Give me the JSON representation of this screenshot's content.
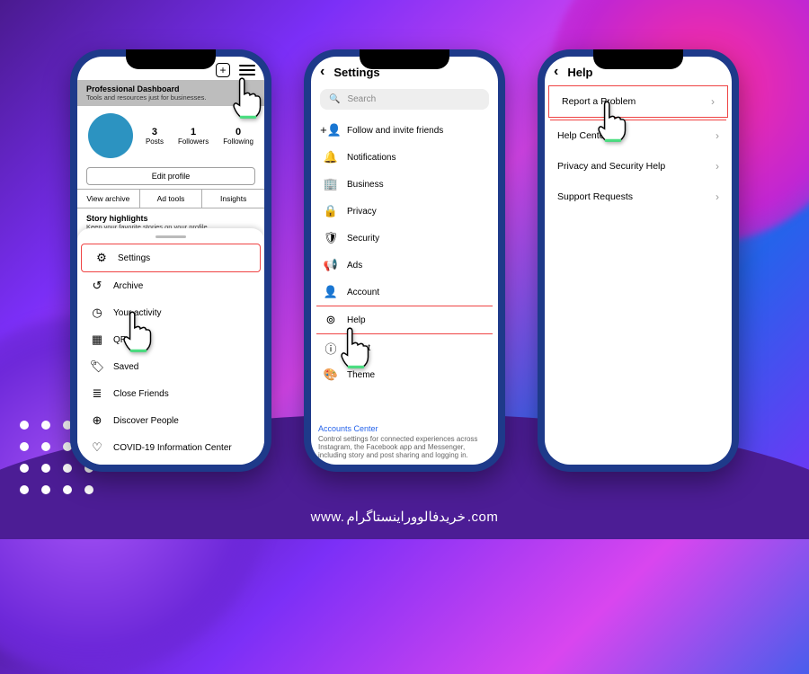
{
  "phone1": {
    "dashboard_title": "Professional Dashboard",
    "dashboard_sub": "Tools and resources just for businesses.",
    "stats": {
      "posts_n": "3",
      "posts_l": "Posts",
      "followers_n": "1",
      "followers_l": "Followers",
      "following_n": "0",
      "following_l": "Following"
    },
    "edit": "Edit profile",
    "tabs": {
      "a": "View archive",
      "b": "Ad tools",
      "c": "Insights"
    },
    "highlights_t": "Story highlights",
    "highlights_s": "Keep your favorite stories on your profile",
    "sheet": {
      "settings": "Settings",
      "archive": "Archive",
      "activity": "Your activity",
      "qr": "QR code",
      "saved": "Saved",
      "close": "Close Friends",
      "discover": "Discover People",
      "covid": "COVID-19 Information Center"
    }
  },
  "phone2": {
    "title": "Settings",
    "search_ph": "Search",
    "items": {
      "follow": "Follow and invite friends",
      "notif": "Notifications",
      "business": "Business",
      "privacy": "Privacy",
      "security": "Security",
      "ads": "Ads",
      "account": "Account",
      "help": "Help",
      "about": "About",
      "theme": "Theme"
    },
    "accounts_link": "Accounts Center",
    "accounts_desc": "Control settings for connected experiences across Instagram, the Facebook app and Messenger, including story and post sharing and logging in."
  },
  "phone3": {
    "title": "Help",
    "report": "Report a Problem",
    "helpcenter": "Help Center",
    "privacy": "Privacy and Security Help",
    "support": "Support Requests"
  },
  "watermark": {
    "www": "www.",
    "fa": "خریدفالووراینستاگرام",
    "com": ".com"
  }
}
